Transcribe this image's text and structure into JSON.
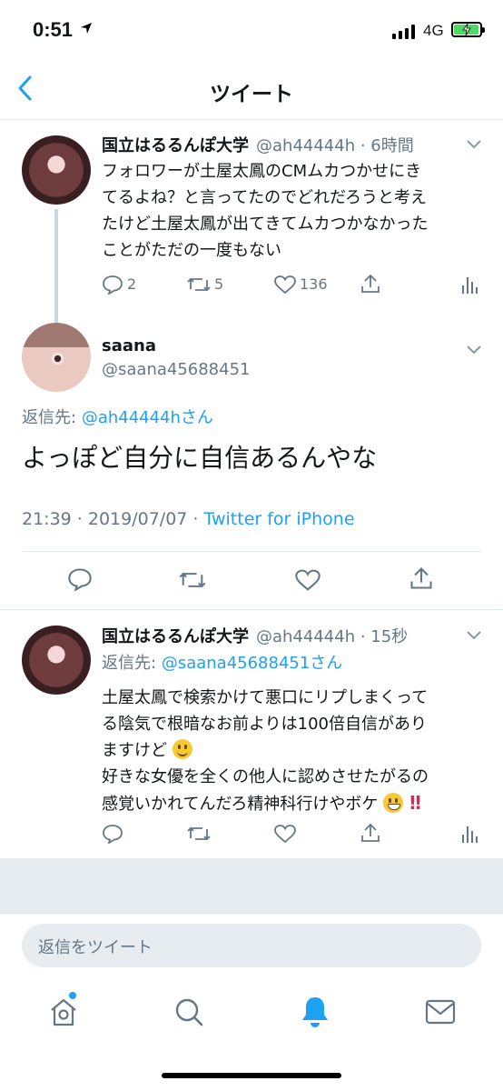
{
  "status_bar": {
    "time": "0:51",
    "network": "4G"
  },
  "header": {
    "title": "ツイート"
  },
  "tweet1": {
    "author_name": "国立はるるんぽ大学",
    "handle_time": "@ah44444h · 6時間",
    "lines": [
      "フォロワーが土屋太鳳のCMムカつかせにき",
      "てるよね？と言ってたのでどれだろうと考え",
      "たけど土屋太鳳が出てきてムカつかなかった",
      "ことがただの一度もない"
    ],
    "replies": "2",
    "retweets": "5",
    "likes": "136"
  },
  "main_tweet": {
    "author_name": "saana",
    "handle": "@saana45688451",
    "reply_to_label": "返信先:",
    "reply_to_handle": "@ah44444hさん",
    "text": "よっぽど自分に自信あるんやな",
    "timestamp": "21:39 · 2019/07/07 · ",
    "source": "Twitter for iPhone"
  },
  "tweet3": {
    "author_name": "国立はるるんぽ大学",
    "handle_time": "@ah44444h · 15秒",
    "reply_to_label": "返信先:",
    "reply_to_handle": "@saana45688451さん",
    "line1": "土屋太鳳で検索かけて悪口にリプしまくって",
    "line2": "る陰気で根暗なお前よりは100倍自信があり",
    "line3": "ますけど",
    "line4": "好きな女優を全くの他人に認めさせたがるの",
    "line5": "感覚いかれてんだろ精神科行けやボケ",
    "line5_tail": "!!"
  },
  "reply_bar": {
    "placeholder": "返信をツイート"
  },
  "colors": {
    "accent": "#1da1f2",
    "secondary_text": "#657786",
    "divider": "#e1e8ed",
    "background_band": "#e6ecf0",
    "battery": "#4cd964"
  },
  "icons": [
    "back-chevron",
    "reply",
    "retweet",
    "like",
    "share",
    "analytics",
    "home",
    "search",
    "notifications-bell",
    "messages-envelope"
  ]
}
